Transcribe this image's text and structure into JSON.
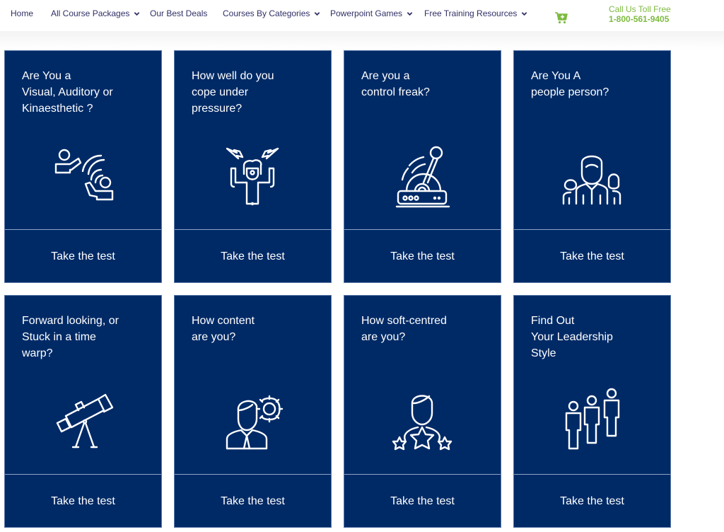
{
  "nav": {
    "items": [
      {
        "label": "Home",
        "has_dropdown": false
      },
      {
        "label": "All Course Packages",
        "has_dropdown": true
      },
      {
        "label": "Our Best Deals",
        "has_dropdown": false
      },
      {
        "label": "Courses By Categories",
        "has_dropdown": true
      },
      {
        "label": "Powerpoint Games",
        "has_dropdown": true
      },
      {
        "label": "Free Training Resources",
        "has_dropdown": true
      }
    ],
    "cart_icon": "cart-plus-icon",
    "call_label": "Call Us Toll Free",
    "phone": "1-800-561-9405"
  },
  "colors": {
    "card_bg": "#002a66",
    "nav_text": "#2f2f66",
    "accent_green": "#7dbb3f"
  },
  "cards": [
    {
      "title": "Are You a\nVisual, Auditory or\nKinaesthetic ?",
      "icon": "communication-people-icon",
      "cta": "Take the test"
    },
    {
      "title": "How well do you\ncope under\npressure?",
      "icon": "stressed-person-icon",
      "cta": "Take the test"
    },
    {
      "title": "Are you a\ncontrol freak?",
      "icon": "control-lever-icon",
      "cta": "Take the test"
    },
    {
      "title": "Are You A\npeople person?",
      "icon": "group-people-icon",
      "cta": "Take the test"
    },
    {
      "title": "Forward looking, or\nStuck in a time\nwarp?",
      "icon": "telescope-icon",
      "cta": "Take the test"
    },
    {
      "title": "How content\nare you?",
      "icon": "person-gear-icon",
      "cta": "Take the test"
    },
    {
      "title": "How soft-centred\nare you?",
      "icon": "person-stars-icon",
      "cta": "Take the test"
    },
    {
      "title": "Find Out\nYour Leadership\nStyle",
      "icon": "leadership-people-icon",
      "cta": "Take the test"
    }
  ]
}
